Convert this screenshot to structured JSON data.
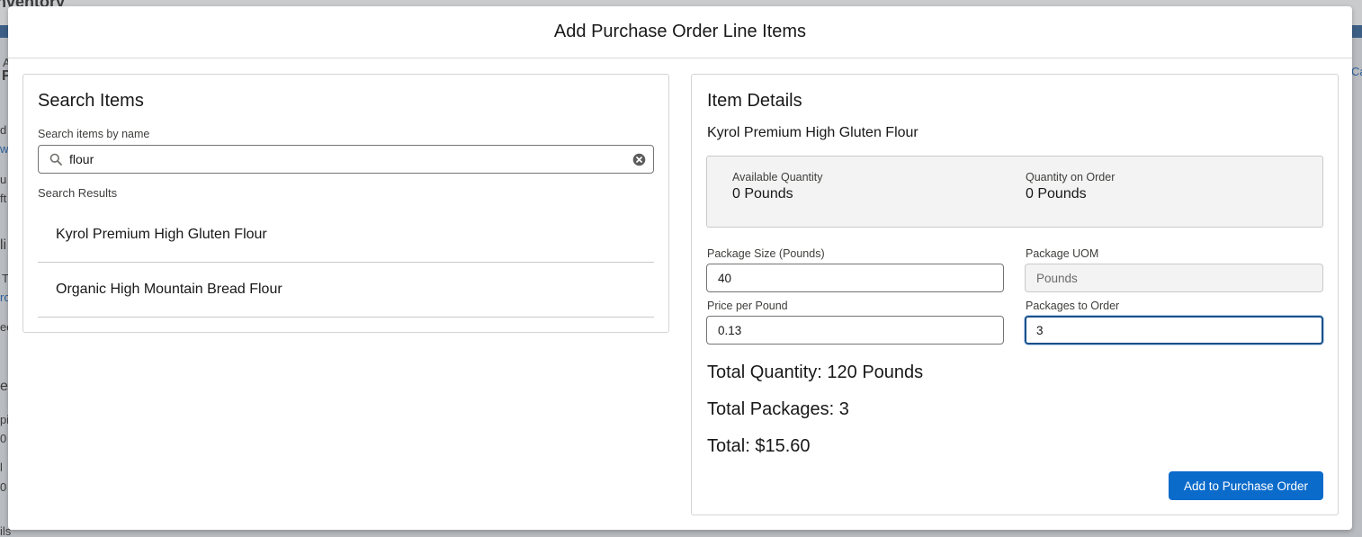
{
  "background": {
    "app_title": "nventory",
    "fragments": [
      "A",
      "F",
      "d",
      "w",
      "u",
      "ft",
      "li",
      "T",
      "ro",
      "ec",
      "es",
      "pi",
      "0",
      "l",
      "0",
      "ils",
      "Ca"
    ]
  },
  "modal": {
    "title": "Add Purchase Order Line Items"
  },
  "search_panel": {
    "heading": "Search Items",
    "search_label": "Search items by name",
    "search_value": "flour",
    "results_label": "Search Results",
    "results": [
      {
        "name": "Kyrol Premium High Gluten Flour"
      },
      {
        "name": "Organic High Mountain Bread Flour"
      }
    ]
  },
  "details_panel": {
    "heading": "Item Details",
    "item_name": "Kyrol Premium High Gluten Flour",
    "available_quantity_label": "Available Quantity",
    "available_quantity_value": "0 Pounds",
    "quantity_on_order_label": "Quantity on Order",
    "quantity_on_order_value": "0 Pounds",
    "package_size_label": "Package Size (Pounds)",
    "package_size_value": "40",
    "package_uom_label": "Package UOM",
    "package_uom_value": "Pounds",
    "price_per_pound_label": "Price per Pound",
    "price_per_pound_value": "0.13",
    "packages_to_order_label": "Packages to Order",
    "packages_to_order_value": "3",
    "total_quantity": "Total Quantity: 120 Pounds",
    "total_packages": "Total Packages: 3",
    "total": "Total: $15.60",
    "add_button_label": "Add to Purchase Order"
  },
  "colors": {
    "primary": "#0b6bcb",
    "focus_border": "#1b4f8a",
    "background_band": "#3d5f86"
  }
}
